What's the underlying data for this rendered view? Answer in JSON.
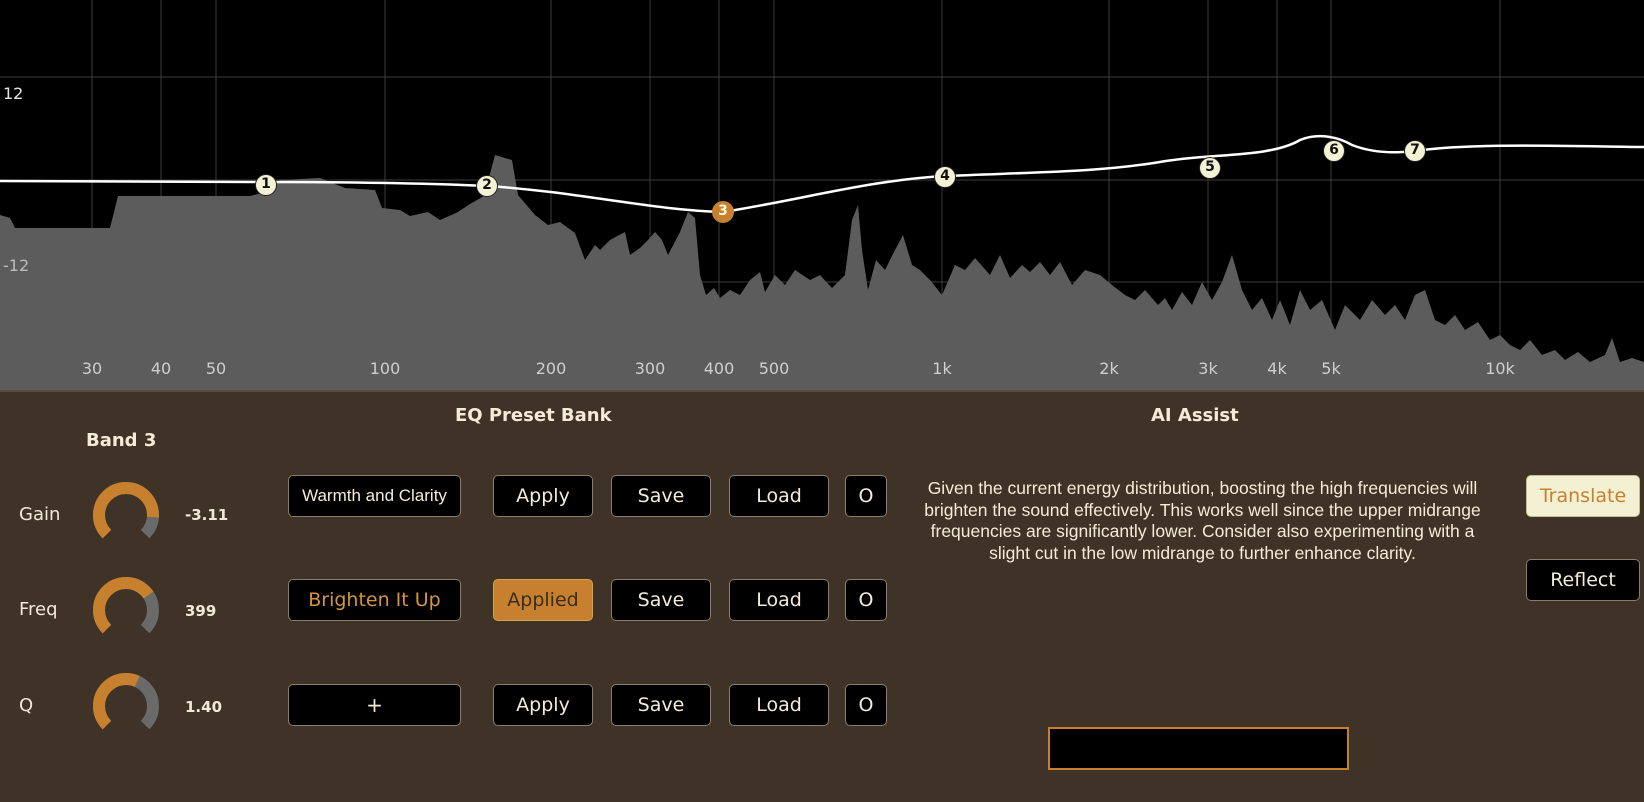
{
  "graph": {
    "db_labels": [
      "12",
      "-12"
    ],
    "freq_labels": [
      "30",
      "40",
      "50",
      "100",
      "200",
      "300",
      "400",
      "500",
      "1k",
      "2k",
      "3k",
      "4k",
      "5k",
      "10k"
    ],
    "bands": [
      {
        "label": "1",
        "active": false
      },
      {
        "label": "2",
        "active": false
      },
      {
        "label": "3",
        "active": true
      },
      {
        "label": "4",
        "active": false
      },
      {
        "label": "5",
        "active": false
      },
      {
        "label": "6",
        "active": false
      },
      {
        "label": "7",
        "active": false
      }
    ]
  },
  "band_panel": {
    "title": "Band 3",
    "gain": {
      "label": "Gain",
      "value": "-3.11"
    },
    "freq": {
      "label": "Freq",
      "value": "399"
    },
    "q": {
      "label": "Q",
      "value": "1.40"
    }
  },
  "preset_bank": {
    "title": "EQ Preset Bank",
    "rows": [
      {
        "name": "Warmth and Clarity",
        "apply": "Apply",
        "save": "Save",
        "load": "Load",
        "extra": "O"
      },
      {
        "name": "Brighten It Up",
        "apply": "Applied",
        "save": "Save",
        "load": "Load",
        "extra": "O"
      },
      {
        "name": "+",
        "apply": "Apply",
        "save": "Save",
        "load": "Load",
        "extra": "O"
      }
    ]
  },
  "ai_assist": {
    "title": "AI Assist",
    "message": "Given the current energy distribution, boosting the high frequencies will brighten the sound effectively. This works well since the upper midrange frequencies are significantly lower. Consider also experimenting with a slight cut in the low midrange to further enhance clarity.",
    "translate_label": "Translate",
    "reflect_label": "Reflect",
    "input_value": ""
  },
  "colors": {
    "accent": "#c6802e",
    "panel_bg": "#3e3326",
    "node_fill": "#f4f1d4",
    "spectrum_fill": "#5c5c5c"
  }
}
